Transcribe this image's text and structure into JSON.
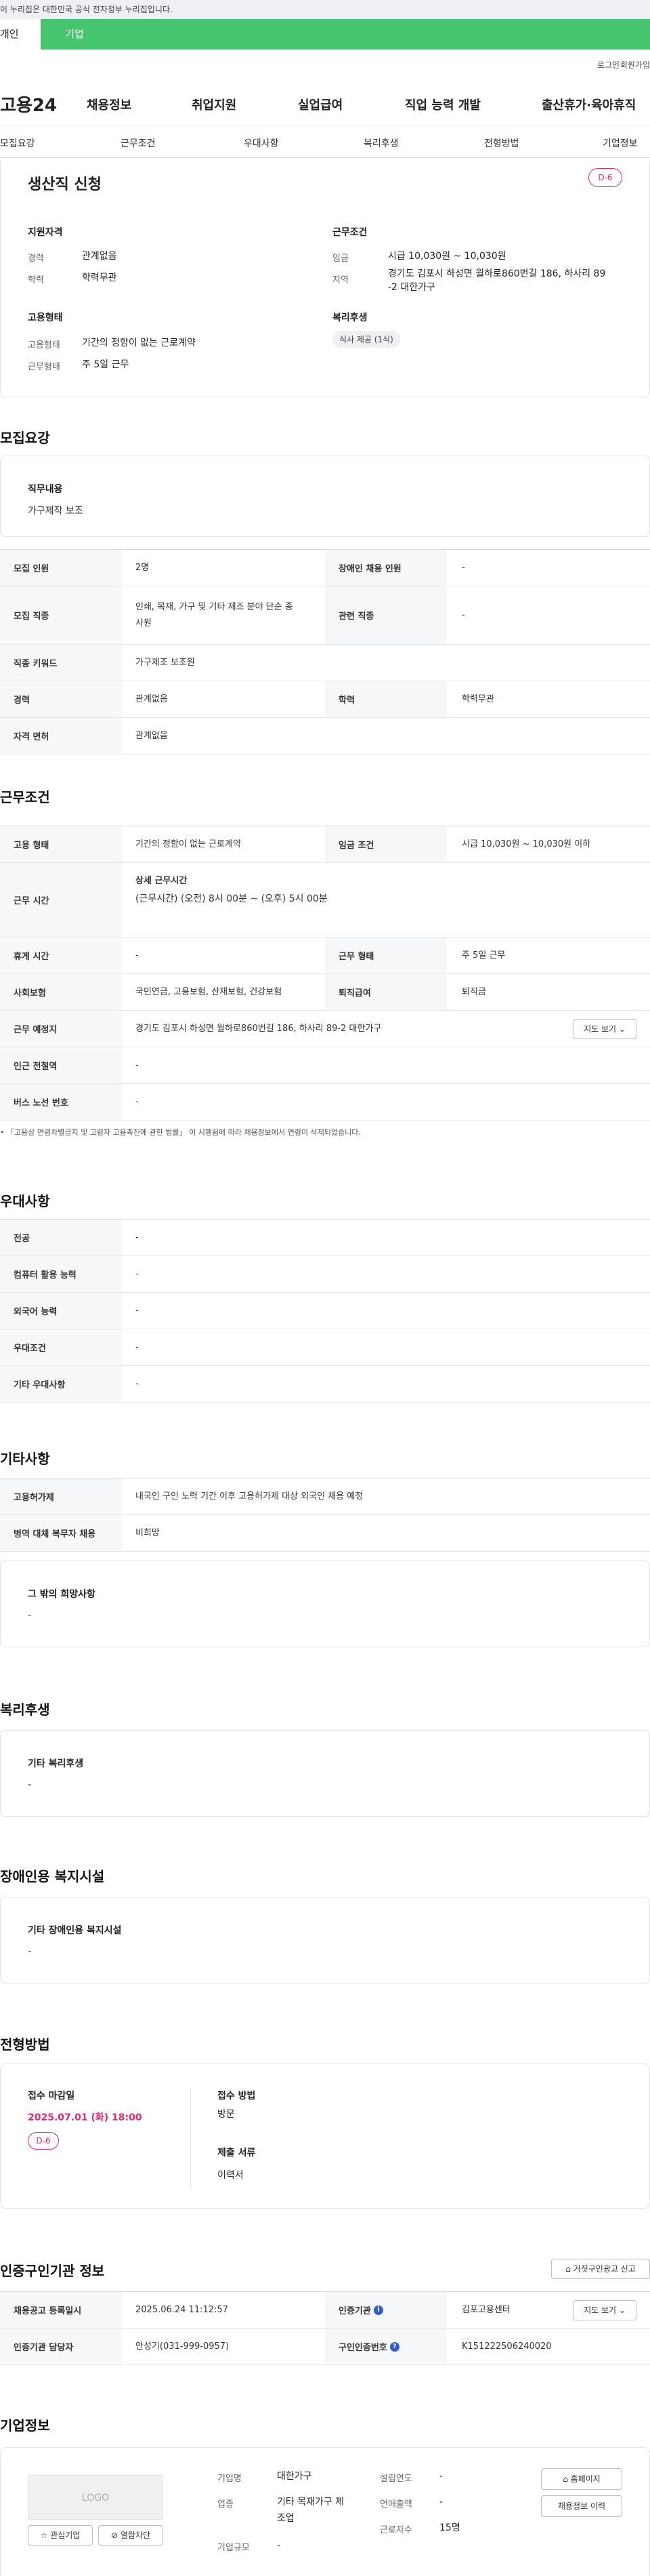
{
  "gov_banner": "이 누리집은 대한민국 공식 전자정부 누리집입니다.",
  "type_tabs": [
    "개인",
    "기업"
  ],
  "util": {
    "login": "로그인",
    "join": "회원가입"
  },
  "gnb": {
    "logo": "고용24",
    "menus": [
      "채용정보",
      "취업지원",
      "실업급여",
      "직업 능력 개발",
      "출산휴가·육아휴직"
    ]
  },
  "anchor_nav": [
    "모집요강",
    "근무조건",
    "우대사항",
    "복리후생",
    "전형방법",
    "기업정보"
  ],
  "summary": {
    "title": "생산직 신청",
    "dday": "D-6",
    "qual_heading": "지원자격",
    "career_label": "경력",
    "career_value": "관계없음",
    "edu_label": "학력",
    "edu_value": "학력무관",
    "emp_heading": "고용형태",
    "emptype_label": "고용형태",
    "emptype_value": "기간의 정함이 없는 근로계약",
    "worktype_label": "근무형태",
    "worktype_value": "주 5일 근무",
    "cond_heading": "근무조건",
    "wage_label": "임금",
    "wage_value": "시급 10,030원 ~ 10,030원",
    "area_label": "지역",
    "area_value_1": "경기도 김포시 하성면 월하로860번길 186, 하사리 89",
    "area_value_2": "-2 대한가구",
    "welfare_heading": "복리후생",
    "welfare_chip": "식사 제공 (1식)"
  },
  "recruit": {
    "title": "모집요강",
    "duty_heading": "직무내용",
    "duty_value": "가구제작 보조",
    "rows": {
      "count_label": "모집 인원",
      "count_value": "2명",
      "disabled_label": "장애인 채용 인원",
      "disabled_value": "-",
      "job_label": "모집 직종",
      "job_value_1": "인쇄, 목재, 가구 및 기타 제조 분야 단순 종",
      "job_value_2": "사원",
      "related_label": "관련 직종",
      "related_value": "-",
      "keyword_label": "직종 키워드",
      "keyword_value": "가구제조 보조원",
      "career_label": "경력",
      "career_value": "관계없음",
      "edu_label": "학력",
      "edu_value": "학력무관",
      "license_label": "자격 면허",
      "license_value": "관계없음"
    }
  },
  "work": {
    "title": "근무조건",
    "emptype_label": "고용 형태",
    "emptype_value": "기간의 정함이 없는 근로계약",
    "wage_label": "임금 조건",
    "wage_value": "시급 10,030원 ~ 10,030원 이하",
    "hours_label": "근무 시간",
    "hours_heading": "상세 근무시간",
    "hours_value": "(근무시간) (오전) 8시 00분 ~ (오후) 5시 00분",
    "break_label": "휴게 시간",
    "break_value": "-",
    "worktype_label": "근무 형태",
    "worktype_value": "주 5일 근무",
    "insurance_label": "사회보험",
    "insurance_value": "국민연금, 고용보험, 산재보험, 건강보험",
    "severance_label": "퇴직급여",
    "severance_value": "퇴직금",
    "place_label": "근무 예정지",
    "place_value": "경기도 김포시 하성면 월하로860번길 186, 하사리 89-2 대한가구",
    "map_button": "지도 보기",
    "station_label": "인근 전철역",
    "station_value": "-",
    "bus_label": "버스 노선 번호",
    "bus_value": "-",
    "note": "「고용상 연령차별금지 및 고령자 고용촉진에 관한 법률」 이 시행됨에 따라 채용정보에서 연령이 삭제되었습니다."
  },
  "pref": {
    "title": "우대사항",
    "major_label": "전공",
    "major_value": "-",
    "pc_label": "컴퓨터 활용 능력",
    "pc_value": "-",
    "lang_label": "외국어 능력",
    "lang_value": "-",
    "cond_label": "우대조건",
    "cond_value": "-",
    "etc_label": "기타 우대사항",
    "etc_value": "-"
  },
  "etc": {
    "title": "기타사항",
    "permit_label": "고용허가제",
    "permit_value": "내국인 구인 노력 기간 이후 고용허가제 대상 외국인 채용 예정",
    "military_label": "병역 대체 복무자 채용",
    "military_value": "비희망",
    "hope_heading": "그 밖의 희망사항",
    "hope_value": "-"
  },
  "welfare": {
    "title": "복리후생",
    "heading": "기타 복리후생",
    "value": "-"
  },
  "disability": {
    "title": "장애인용 복지시설",
    "heading": "기타 장애인용 복지시설",
    "value": "-"
  },
  "selection": {
    "title": "전형방법",
    "deadline_label": "접수 마감일",
    "deadline_value": "2025.07.01 (화) 18:00",
    "dday": "D-6",
    "method_label": "접수 방법",
    "method_value": "방문",
    "docs_label": "제출 서류",
    "docs_value": "이력서"
  },
  "agency": {
    "title": "인증구인기관 정보",
    "report_button": "거짓구인광고 신고",
    "reg_label": "채용공고 등록일시",
    "reg_value": "2025.06.24 11:12:57",
    "org_label": "인증기관",
    "org_value": "김포고용센터",
    "map_button": "지도 보기",
    "manager_label": "인증기관 담당자",
    "manager_value": "안성기(031-999-0957)",
    "num_label": "구인인증번호",
    "num_value": "K151222506240020"
  },
  "company": {
    "title": "기업정보",
    "logo_text": "LOGO",
    "fav_button": "관심기업",
    "block_button": "열람차단",
    "name_label": "기업명",
    "name_value": "대한가구",
    "industry_label": "업종",
    "industry_value_1": "기타 목재가구 제",
    "industry_value_2": "조업",
    "scale_label": "기업규모",
    "scale_value": "-",
    "founded_label": "설립연도",
    "founded_value": "-",
    "revenue_label": "연매출액",
    "revenue_value": "-",
    "staff_label": "근로자수",
    "staff_value": "15명",
    "home_button": "홈페이지",
    "history_button": "채용정보 이력"
  }
}
